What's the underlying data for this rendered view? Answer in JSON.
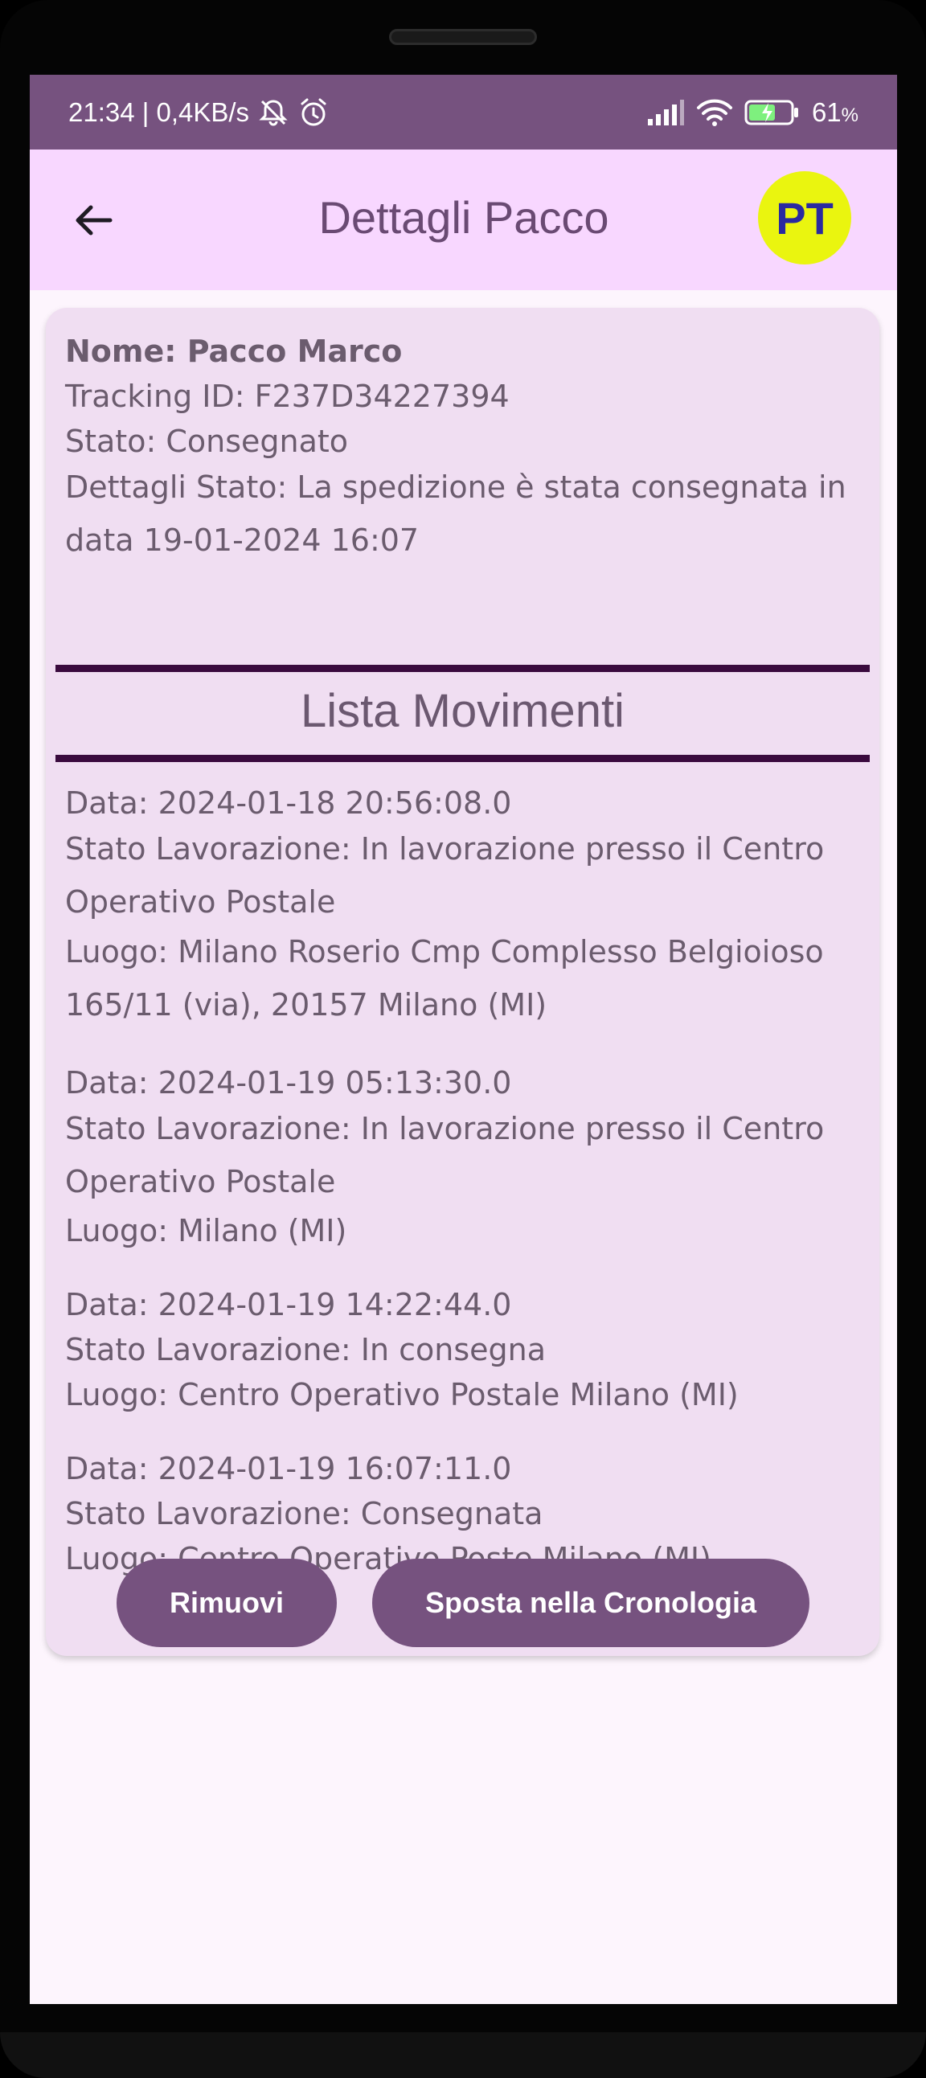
{
  "status_bar": {
    "time_speed": "21:34 | 0,4KB/s",
    "battery": "61",
    "battery_unit": "%"
  },
  "app_bar": {
    "title": "Dettagli Pacco",
    "logo_text": "PT"
  },
  "package": {
    "name": "Nome: Pacco Marco",
    "tracking": "Tracking ID: F237D34227394",
    "state": "Stato: Consegnato",
    "details": "Dettagli Stato: La spedizione è stata consegnata in data 19-01-2024 16:07"
  },
  "movements_title": "Lista Movimenti",
  "movements": [
    {
      "date": "Data: 2024-01-18 20:56:08.0",
      "status": "Stato Lavorazione: In lavorazione presso il Centro Operativo Postale",
      "place": "Luogo: Milano Roserio Cmp Complesso Belgioioso 165/11 (via), 20157 Milano (MI)"
    },
    {
      "date": "Data: 2024-01-19 05:13:30.0",
      "status": "Stato Lavorazione: In lavorazione presso il Centro Operativo Postale",
      "place": "Luogo: Milano (MI)"
    },
    {
      "date": "Data: 2024-01-19 14:22:44.0",
      "status": "Stato Lavorazione: In consegna",
      "place": "Luogo: Centro Operativo Postale Milano (MI)"
    },
    {
      "date": "Data: 2024-01-19 16:07:11.0",
      "status": "Stato Lavorazione: Consegnata",
      "place": "Luogo: Centro Operativo Poste Milano (MI)"
    }
  ],
  "buttons": {
    "remove": "Rimuovi",
    "move_history": "Sposta nella Cronologia"
  },
  "colors": {
    "primary": "#76527f",
    "app_bar": "#f8d7ff",
    "card": "#f0def2",
    "divider": "#3a0a3e",
    "logo_bg": "#eaf50f",
    "logo_text": "#2a2aa0"
  }
}
